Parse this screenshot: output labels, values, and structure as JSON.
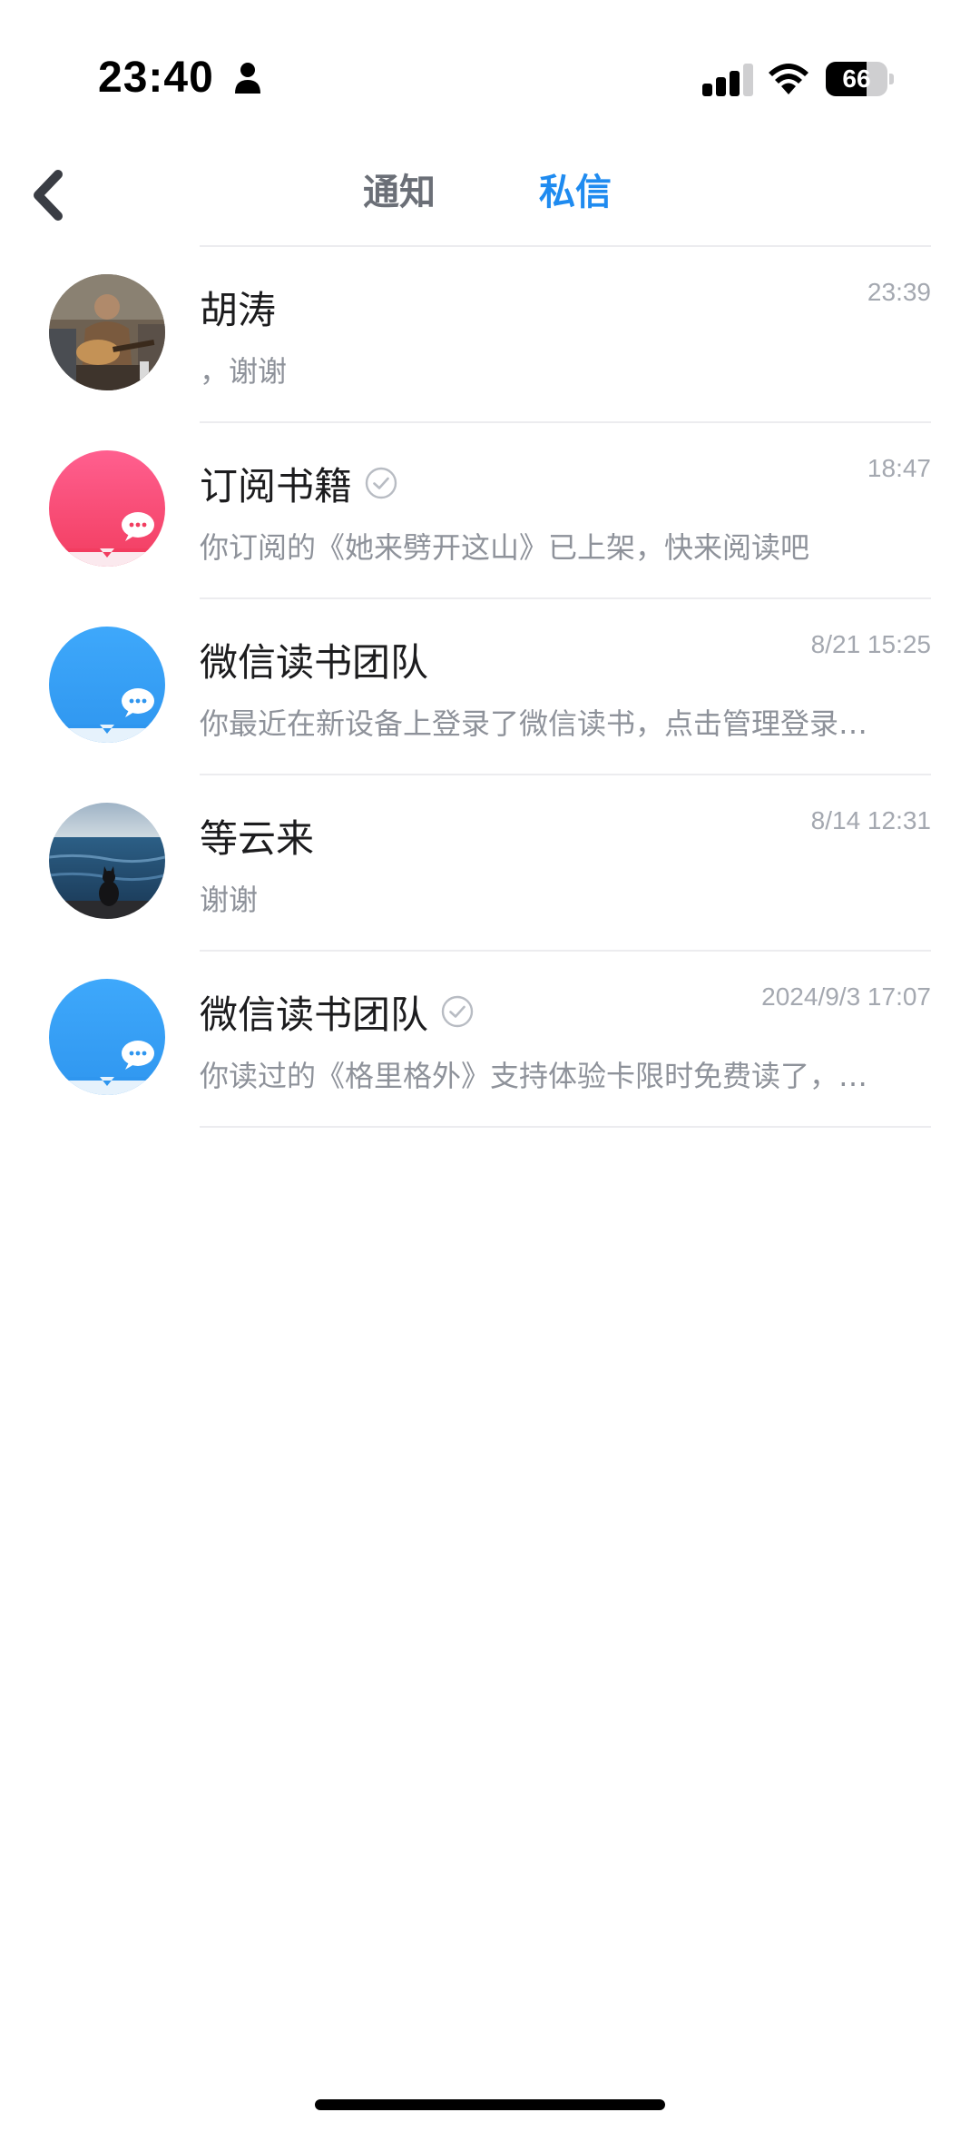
{
  "status_bar": {
    "time": "23:40",
    "battery_level": "66",
    "battery_percent": 66,
    "icons": [
      "person-icon",
      "cellular-signal-icon",
      "wifi-icon",
      "battery-icon"
    ]
  },
  "nav": {
    "back_icon": "chevron-left-icon",
    "tabs": [
      {
        "label": "通知",
        "active": false
      },
      {
        "label": "私信",
        "active": true
      }
    ]
  },
  "colors": {
    "accent": "#1f8bf0",
    "tab_inactive": "#6b6f77",
    "secondary_text": "#8e929a",
    "time_text": "#a4a8b0",
    "divider": "#ececef",
    "pink_avatar": "#f64f7f",
    "blue_avatar": "#36a2f5"
  },
  "messages": [
    {
      "name": "胡涛",
      "preview": "，谢谢",
      "time": "23:39",
      "verified": false,
      "avatar": "photo-guitar-player"
    },
    {
      "name": "订阅书籍",
      "preview": "你订阅的《她来劈开这山》已上架，快来阅读吧",
      "time": "18:47",
      "verified": true,
      "avatar": "pink-message-icon"
    },
    {
      "name": "微信读书团队",
      "preview": "你最近在新设备上登录了微信读书，点击管理登录…",
      "time": "8/21 15:25",
      "verified": false,
      "avatar": "blue-message-icon"
    },
    {
      "name": "等云来",
      "preview": "谢谢",
      "time": "8/14 12:31",
      "verified": false,
      "avatar": "photo-cat-by-sea"
    },
    {
      "name": "微信读书团队",
      "preview": "你读过的《格里格外》支持体验卡限时免费读了，…",
      "time": "2024/9/3 17:07",
      "verified": true,
      "avatar": "blue-message-icon"
    }
  ]
}
